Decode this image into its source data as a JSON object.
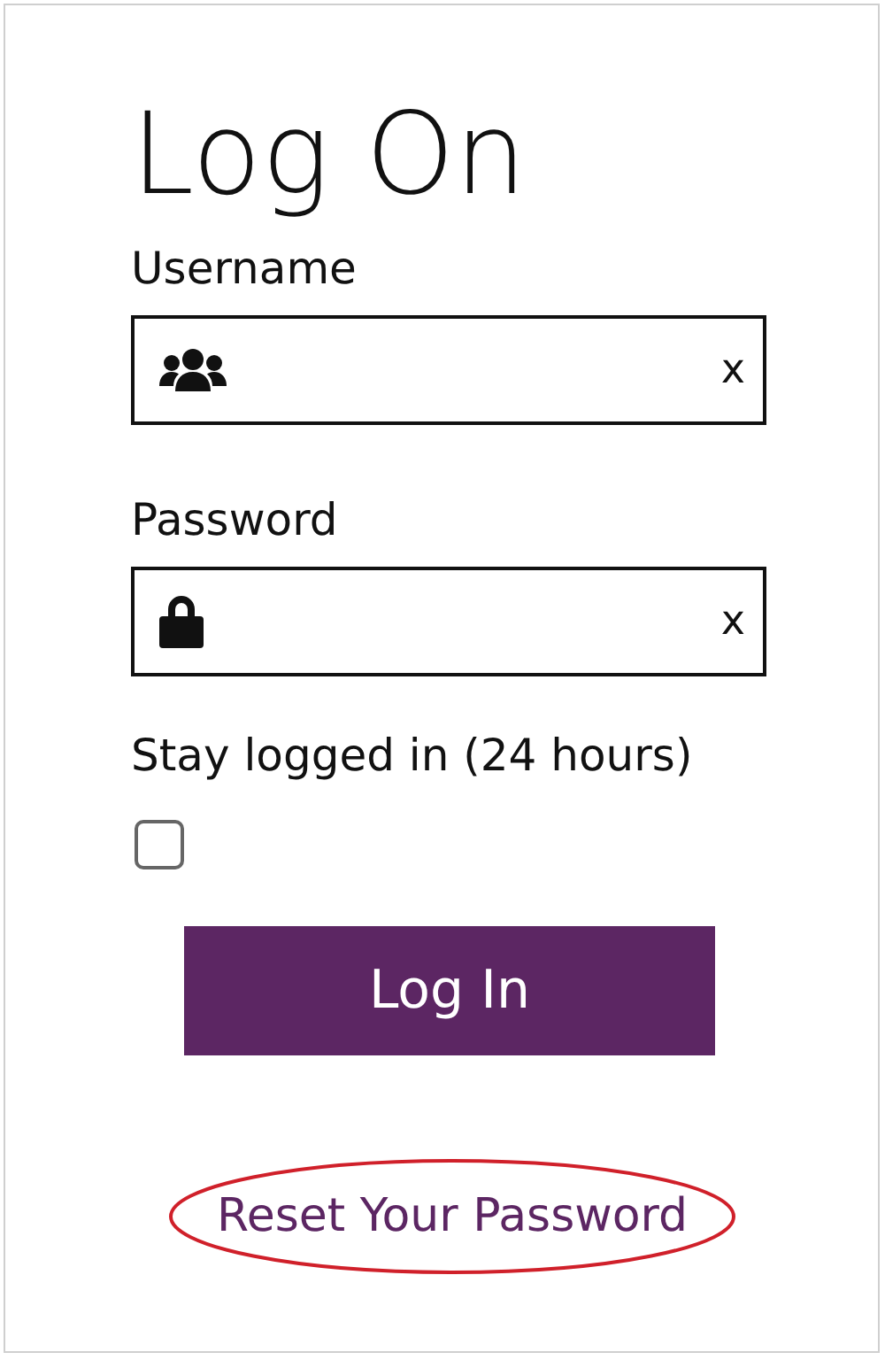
{
  "title": "Log On",
  "fields": [
    {
      "label": "Username",
      "kind": "username",
      "clear": "x"
    },
    {
      "label": "Password",
      "kind": "password",
      "clear": "x"
    }
  ],
  "stay_logged_in": {
    "label": "Stay logged in (24 hours)",
    "checked": false
  },
  "submit": {
    "label": "Log In"
  },
  "reset_link": {
    "label": "Reset Your Password",
    "circled": true
  }
}
